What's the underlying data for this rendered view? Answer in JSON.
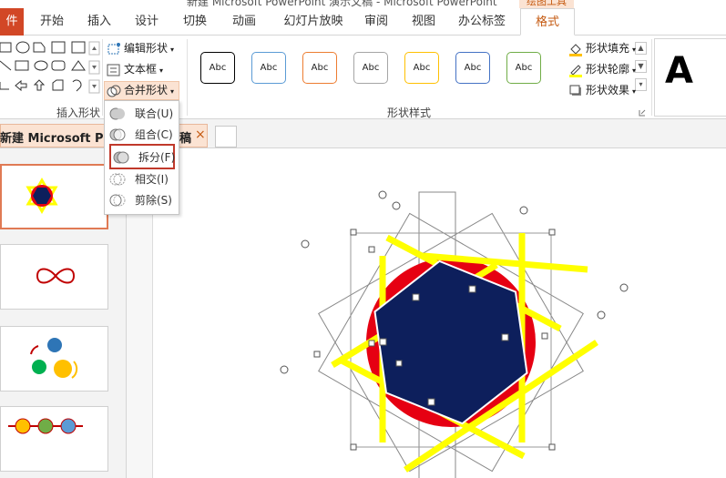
{
  "window": {
    "title": "新建 Microsoft PowerPoint 演示文稿 - Microsoft PowerPoint",
    "contextual_tab_group": "绘图工具"
  },
  "tabs": {
    "file": "件",
    "items": [
      "开始",
      "插入",
      "设计",
      "切换",
      "动画",
      "幻灯片放映",
      "审阅",
      "视图",
      "办公标签"
    ],
    "active": "格式"
  },
  "ribbon": {
    "insert_shapes_group": "插入形状",
    "edit_shape": "编辑形状",
    "text_box": "文本框",
    "merge_shapes": "合并形状",
    "shape_styles_group": "形状样式",
    "style_swatches": [
      {
        "label": "Abc",
        "border": "#000000"
      },
      {
        "label": "Abc",
        "border": "#5b9bd5"
      },
      {
        "label": "Abc",
        "border": "#ed7d31"
      },
      {
        "label": "Abc",
        "border": "#a5a5a5"
      },
      {
        "label": "Abc",
        "border": "#ffc000"
      },
      {
        "label": "Abc",
        "border": "#4472c4"
      },
      {
        "label": "Abc",
        "border": "#70ad47"
      }
    ],
    "shape_fill": "形状填充",
    "shape_outline": "形状轮廓",
    "shape_effects": "形状效果",
    "wordart_letter": "A"
  },
  "merge_menu": {
    "items": [
      "联合(U)",
      "组合(C)",
      "拆分(F)",
      "相交(I)",
      "剪除(S)"
    ],
    "highlighted_index": 2
  },
  "doc_tab": {
    "title": "新建 Microsoft Powe",
    "title_tail": "稿",
    "close": "×"
  },
  "colors": {
    "accent": "#d24726",
    "active_tab_text": "#c55a11",
    "shape_red": "#e60012",
    "shape_navy": "#0d1f5c",
    "shape_yellow": "#ffff00"
  }
}
